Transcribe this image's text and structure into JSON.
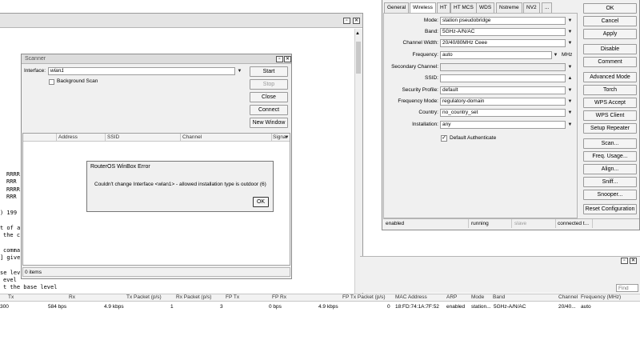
{
  "terminal": {
    "lines": [
      "RRRR",
      "RRR",
      "RRRR",
      "RRR",
      ") 199",
      "t of a",
      "the c",
      "comma",
      "] give",
      "se lev",
      "evel",
      "t the base level"
    ]
  },
  "bg_table": {
    "col_tx": "Tx",
    "col_rx": "Rx",
    "col_tx_packet": "Tx Packet (p/s)",
    "col_rx_packet": "Rx Packet (p/s)",
    "col_fp_tx": "FP Tx",
    "col_fp_rx": "FP Rx",
    "col_fp_tx_packet": "FP Tx Packet (p/s)",
    "col_mac": "MAC Address",
    "col_arp": "ARP",
    "col_mode": "Mode",
    "col_band": "Band",
    "col_channel": "Channel",
    "col_freq": "Frequency (MHz)",
    "row": {
      "c0": "300",
      "tx": "584 bps",
      "rx": "4.9 kbps",
      "tx_packet": "1",
      "rx_packet": "3",
      "fp_tx": "0 bps",
      "fp_rx": "4.9 kbps",
      "fp_tx_packet": "0",
      "mac": "18:FD:74:1A:7F:52",
      "arp": "enabled",
      "mode": "station...",
      "band": "5GHz-A/N/AC",
      "channel": "20/40...",
      "freq": "auto"
    },
    "find_placeholder": "Find"
  },
  "scanner": {
    "title": "Scanner",
    "interface_label": "Interface:",
    "interface_value": "wlan1",
    "background_scan_label": "Background Scan",
    "buttons": {
      "start": "Start",
      "stop": "Stop",
      "close": "Close",
      "connect": "Connect",
      "new_window": "New Window"
    },
    "columns": {
      "address": "Address",
      "ssid": "SSID",
      "channel": "Channel",
      "signal": "Signa"
    },
    "status": "0 items"
  },
  "error_dialog": {
    "title": "RouterOS WinBox Error",
    "message": "Couldn't change Interface <wlan1> - allowed installation type is outdoor (6)",
    "ok": "OK"
  },
  "interface_window": {
    "tabs": [
      "General",
      "Wireless",
      "HT",
      "HT MCS",
      "WDS",
      "Nstreme",
      "NV2",
      "..."
    ],
    "active_tab": "Wireless",
    "fields": {
      "mode": {
        "label": "Mode:",
        "value": "station pseudobridge"
      },
      "band": {
        "label": "Band:",
        "value": "5GHz-A/N/AC"
      },
      "channel_width": {
        "label": "Channel Width:",
        "value": "20/40/80MHz Ceee"
      },
      "frequency": {
        "label": "Frequency:",
        "value": "auto",
        "unit": "MHz"
      },
      "secondary_channel": {
        "label": "Secondary Channel:",
        "value": ""
      },
      "ssid": {
        "label": "SSID:",
        "value": ""
      },
      "security_profile": {
        "label": "Security Profile:",
        "value": "default"
      },
      "frequency_mode": {
        "label": "Frequency Mode:",
        "value": "regulatory-domain"
      },
      "country": {
        "label": "Country:",
        "value": "no_country_set"
      },
      "installation": {
        "label": "Installation:",
        "value": "any"
      }
    },
    "default_authenticate_label": "Default Authenticate",
    "default_authenticate_checked": true,
    "buttons": [
      "OK",
      "Cancel",
      "Apply",
      "Disable",
      "Comment",
      "Advanced Mode",
      "Torch",
      "WPS Accept",
      "WPS Client",
      "Setup Repeater",
      "Scan...",
      "Freq. Usage...",
      "Align...",
      "Sniff...",
      "Snooper...",
      "Reset Configuration"
    ],
    "status": {
      "s1": "enabled",
      "s2": "running",
      "s3": "slave",
      "s4": "connected t..."
    }
  }
}
